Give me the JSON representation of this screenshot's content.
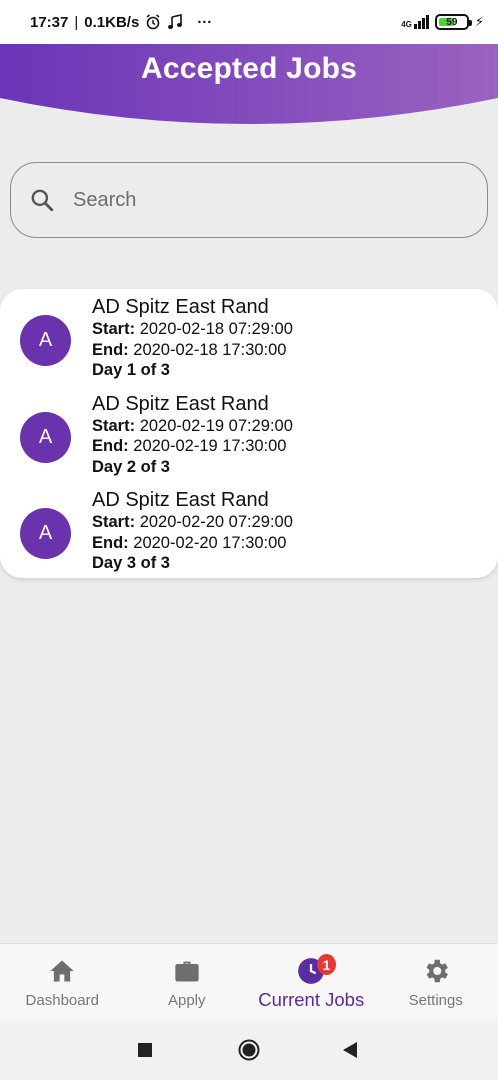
{
  "status_bar": {
    "time": "17:37",
    "separator": "|",
    "net_speed": "0.1KB/s",
    "icons": [
      "alarm-icon",
      "music-icon",
      "more-icon"
    ],
    "more": "···",
    "network_type": "4G",
    "battery_level": "59",
    "battery_fraction": 0.59
  },
  "header": {
    "title": "Accepted Jobs",
    "gradient_start": "#6a35b8",
    "gradient_end": "#9b62c0"
  },
  "search": {
    "placeholder": "Search"
  },
  "jobs": [
    {
      "avatar": "A",
      "title": "AD Spitz East Rand",
      "start_label": "Start:",
      "start": "2020-02-18 07:29:00",
      "end_label": "End:",
      "end": "2020-02-18 17:30:00",
      "day": "Day 1 of 3"
    },
    {
      "avatar": "A",
      "title": "AD Spitz East Rand",
      "start_label": "Start:",
      "start": "2020-02-19 07:29:00",
      "end_label": "End:",
      "end": "2020-02-19 17:30:00",
      "day": "Day 2 of 3"
    },
    {
      "avatar": "A",
      "title": "AD Spitz East Rand",
      "start_label": "Start:",
      "start": "2020-02-20 07:29:00",
      "end_label": "End:",
      "end": "2020-02-20 17:30:00",
      "day": "Day 3 of 3"
    }
  ],
  "bottom_nav": {
    "items": [
      {
        "label": "Dashboard",
        "icon": "home-icon"
      },
      {
        "label": "Apply",
        "icon": "briefcase-icon"
      },
      {
        "label": "Current Jobs",
        "icon": "current-jobs-icon",
        "badge": "1",
        "active": true
      },
      {
        "label": "Settings",
        "icon": "gear-icon"
      }
    ],
    "active_color": "#5b2ba0",
    "badge_color": "#e53935"
  },
  "system_nav": {
    "icons": [
      "recents-square-icon",
      "home-circle-icon",
      "back-triangle-icon"
    ]
  }
}
